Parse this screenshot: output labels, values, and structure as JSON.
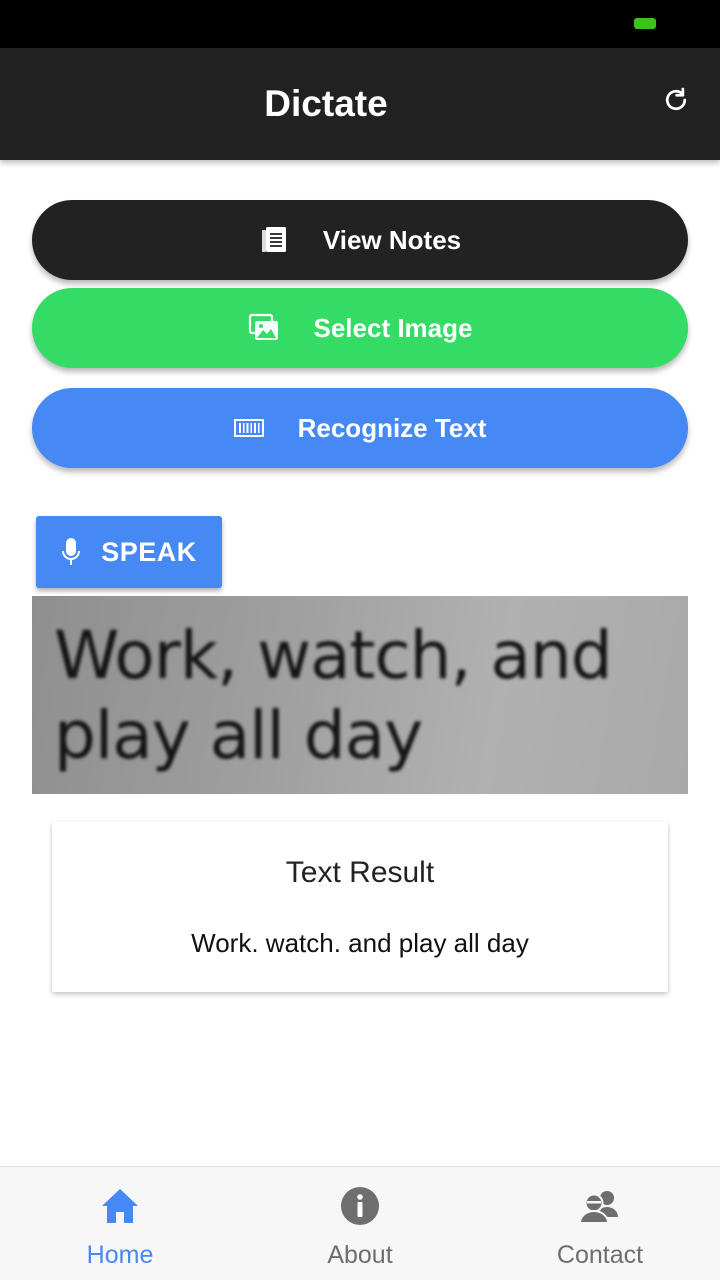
{
  "colors": {
    "status_bar": "#000000",
    "battery": "#3ec21a",
    "app_bar": "#212121",
    "view_notes": "#222222",
    "select_image": "#34dc66",
    "recognize_text": "#4688f4",
    "speak": "#4688f4",
    "nav_active": "#4688f4",
    "nav_inactive": "#6e6e6e"
  },
  "app_bar": {
    "title": "Dictate",
    "refresh_icon": "refresh-icon"
  },
  "buttons": {
    "view_notes": {
      "label": "View Notes",
      "icon": "notes-icon"
    },
    "select_image": {
      "label": "Select Image",
      "icon": "image-icon"
    },
    "recognize_text": {
      "label": "Recognize Text",
      "icon": "barcode-icon"
    },
    "speak": {
      "label": "SPEAK",
      "icon": "microphone-icon"
    }
  },
  "photo": {
    "text": "Work, watch, and\nplay all day"
  },
  "result": {
    "title": "Text Result",
    "text": "Work. watch. and play all day"
  },
  "bottom_nav": {
    "active": "home",
    "items": [
      {
        "id": "home",
        "label": "Home",
        "icon": "home-icon"
      },
      {
        "id": "about",
        "label": "About",
        "icon": "info-icon"
      },
      {
        "id": "contact",
        "label": "Contact",
        "icon": "contacts-icon"
      }
    ]
  }
}
